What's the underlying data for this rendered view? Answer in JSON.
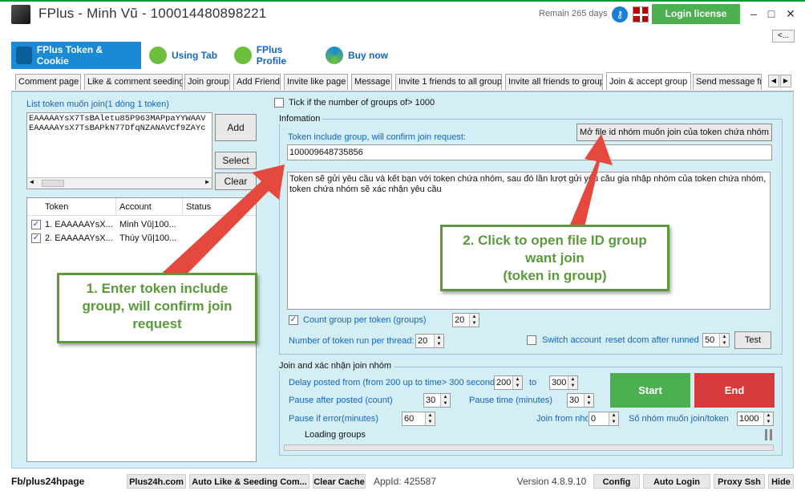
{
  "window": {
    "title": "FPlus - Minh Vũ - 100014480898221",
    "remain": "Remain 265 days",
    "login_license": "Login license",
    "minimize": "–",
    "maximize": "□",
    "close": "✕",
    "collapse": "<..."
  },
  "main_tabs": [
    "FPlus Token & Cookie",
    "Using Tab",
    "FPlus Profile",
    "Buy now"
  ],
  "sub_tabs": [
    "Comment page",
    "Like & comment seeding",
    "Join group",
    "Add Friend",
    "Invite like page",
    "Message",
    "Invite 1 friends to all group",
    "Invite all friends to group",
    "Join & accept group",
    "Send message fr"
  ],
  "left": {
    "list_label": "List token muốn join(1 dòng 1 token)",
    "tokens_text": [
      "EAAAAAYsX7TsBAletu85P963MAPpaYYWAAV",
      "EAAAAAYsX7TsBAPkN77DfqNZANAVCf9ZAYc"
    ],
    "add": "Add",
    "select": "Select",
    "clear": "Clear",
    "columns": [
      "Token",
      "Account",
      "Status"
    ],
    "rows": [
      {
        "token": "1. EAAAAAYsX...",
        "account": "Minh Vũ|100...",
        "status": ""
      },
      {
        "token": "2. EAAAAAYsX...",
        "account": "Thúy Vũ|100...",
        "status": ""
      }
    ]
  },
  "right": {
    "tick_label": "Tick if the number of groups of> 1000",
    "info_title": "Infomation",
    "token_group_label": "Token include group, will confirm join request:",
    "open_file_btn": "Mở file id nhóm muốn join của token chứa nhóm",
    "token_group_value": "100009648735856",
    "description": "Token sẽ gửi yêu cầu và kết bạn với token chứa nhóm, sau đó lần lượt gửi yêu cầu gia nhập nhóm của token chứa nhóm, token chứa nhóm sẽ xác nhận yêu cầu",
    "count_group_label": "Count group per token (groups)",
    "count_group_value": "20",
    "threads_label": "Number of token run per thread:",
    "threads_value": "20",
    "switch_label": "Switch account",
    "reset_label": "reset dcom after runned",
    "reset_value": "50",
    "test_btn": "Test",
    "join_title": "Join and xác nhận join nhóm",
    "delay_label": "Delay posted from (from 200 up to time> 300 seconds)",
    "delay_from": "200",
    "to_label": "to",
    "delay_to": "300",
    "pause_posted_label": "Pause after posted (count)",
    "pause_posted_value": "30",
    "pause_time_label": "Pause time (minutes)",
    "pause_time_value": "30",
    "pause_error_label": "Pause if error(minutes)",
    "pause_error_value": "60",
    "join_from_label": "Join from nhóm",
    "join_from_value": "0",
    "so_nhom_label": "Số nhóm muốn join/token",
    "so_nhom_value": "1000",
    "loading": "Loading groups",
    "start": "Start",
    "end": "End"
  },
  "annotations": {
    "a1": [
      "1. Enter token include",
      "group, will confirm join",
      "request"
    ],
    "a2": [
      "2. Click to open file ID group",
      "want join",
      "(token in group)"
    ]
  },
  "statusbar": {
    "fb": "Fb/plus24hpage",
    "plus24h": "Plus24h.com",
    "auto_like": "Auto Like & Seeding Com...",
    "clear_cache": "Clear Cache",
    "appid": "AppId: 425587",
    "version": "Version 4.8.9.10",
    "config": "Config",
    "auto_login": "Auto Login",
    "proxy": "Proxy Ssh",
    "hide": "Hide"
  },
  "colors": {
    "accent": "#1a8ad4",
    "start": "#4caf50",
    "end": "#d63a3a",
    "panel": "#d3eef4",
    "arrow": "#e5483d",
    "callout": "#5a9a3a"
  }
}
